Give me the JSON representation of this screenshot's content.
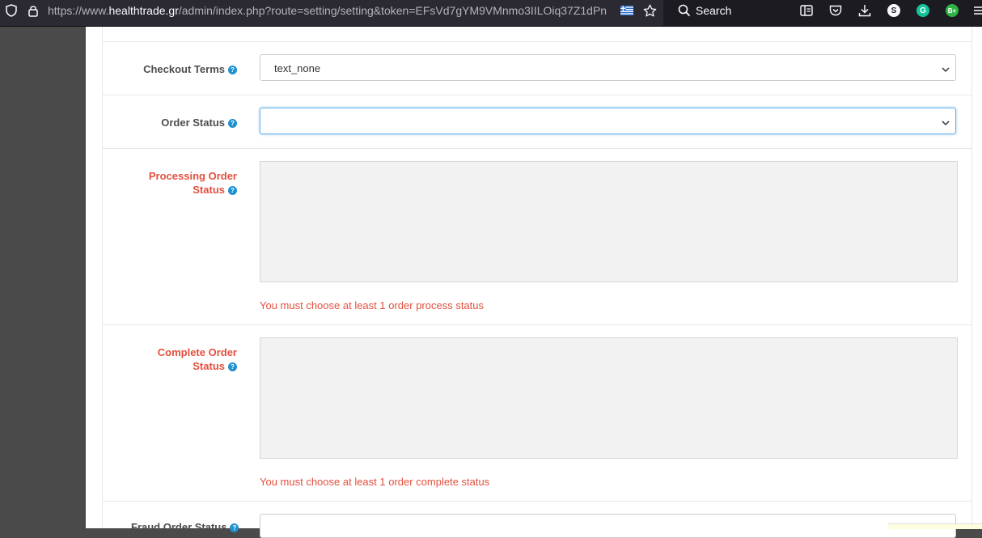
{
  "browser": {
    "url_prefix": "https://www.",
    "url_host": "healthtrade.gr",
    "url_rest": "/admin/index.php?route=setting/setting&token=EFsVd7gYM9VMnmo3IILOiq37Z1dPn",
    "search_label": "Search",
    "extension_badges": [
      "S",
      "G",
      "B+"
    ]
  },
  "form": {
    "checkout_terms": {
      "label": "Checkout Terms",
      "value": "text_none"
    },
    "order_status": {
      "label": "Order Status",
      "value": ""
    },
    "processing_order_status": {
      "label_line1": "Processing Order",
      "label_line2": "Status",
      "error": "You must choose at least 1 order process status"
    },
    "complete_order_status": {
      "label_line1": "Complete Order",
      "label_line2": "Status",
      "error": "You must choose at least 1 order complete status"
    },
    "fraud_order_status": {
      "label": "Fraud Order Status"
    },
    "help_glyph": "?"
  },
  "colors": {
    "error": "#e3503e",
    "help": "#1e91cf",
    "focus_border": "#66afe9"
  }
}
